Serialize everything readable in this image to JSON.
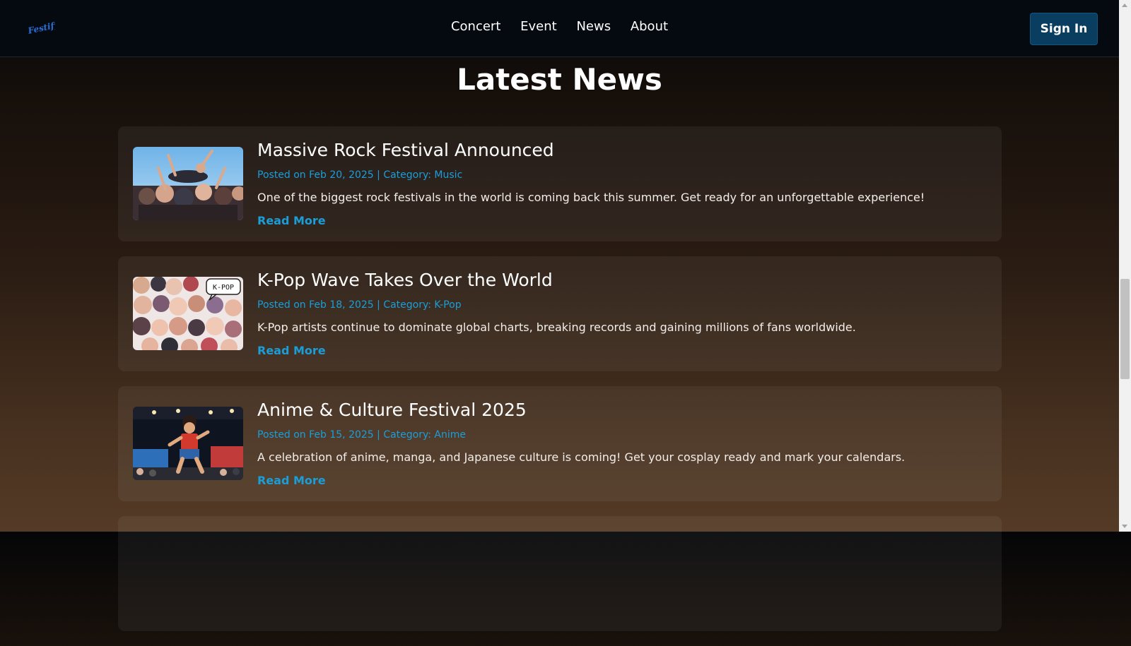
{
  "header": {
    "logo_text": "Festify",
    "nav": [
      "Concert",
      "Event",
      "News",
      "About"
    ],
    "signin_label": "Sign In"
  },
  "page": {
    "title": "Latest News"
  },
  "news": [
    {
      "title": "Massive Rock Festival Announced",
      "meta": "Posted on Feb 20, 2025 | Category: Music",
      "desc": "One of the biggest rock festivals in the world is coming back this summer. Get ready for an unforgettable experience!",
      "link": "Read More"
    },
    {
      "title": "K-Pop Wave Takes Over the World",
      "meta": "Posted on Feb 18, 2025 | Category: K-Pop",
      "desc": "K-Pop artists continue to dominate global charts, breaking records and gaining millions of fans worldwide.",
      "link": "Read More",
      "image_badge": "K-POP"
    },
    {
      "title": "Anime & Culture Festival 2025",
      "meta": "Posted on Feb 15, 2025 | Category: Anime",
      "desc": "A celebration of anime, manga, and Japanese culture is coming! Get your cosplay ready and mark your calendars.",
      "link": "Read More"
    }
  ],
  "colors": {
    "accent": "#1b9ed8",
    "signin_bg": "#0a3e61",
    "nav_bg": "#050a11"
  }
}
